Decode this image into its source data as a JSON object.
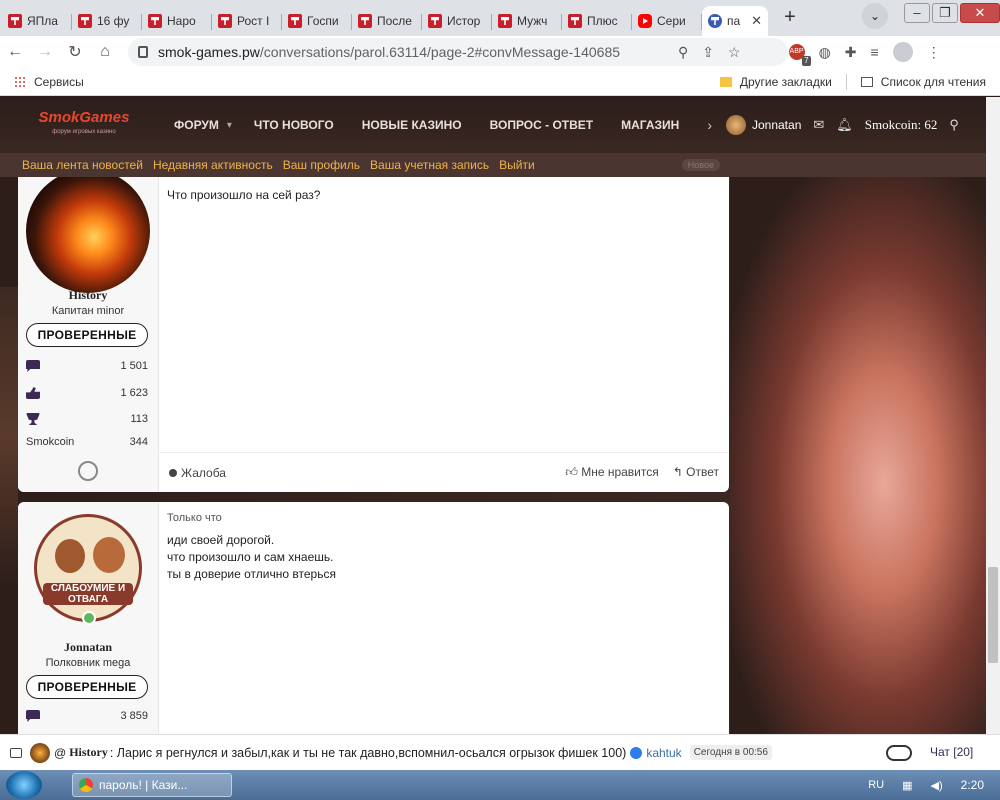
{
  "browser": {
    "tabs": [
      {
        "label": "ЯПла",
        "favicon": "sg-red"
      },
      {
        "label": "16 фу",
        "favicon": "sg-red"
      },
      {
        "label": "Наро",
        "favicon": "sg-red"
      },
      {
        "label": "Рост I",
        "favicon": "sg-red"
      },
      {
        "label": "Госпи",
        "favicon": "sg-red"
      },
      {
        "label": "После",
        "favicon": "sg-red"
      },
      {
        "label": "Истор",
        "favicon": "sg-red"
      },
      {
        "label": "Мужч",
        "favicon": "sg-red"
      },
      {
        "label": "Плюс",
        "favicon": "sg-red"
      },
      {
        "label": "Сери",
        "favicon": "youtube"
      },
      {
        "label": "па",
        "favicon": "smokgames",
        "active": true
      }
    ],
    "url_host": "smok-games.pw",
    "url_path": "/conversations/parol.63114/page-2#convMessage-140685",
    "abp_count": "7",
    "bookmarks": {
      "apps": "Сервисы",
      "other": "Другие закладки",
      "reading_list": "Список для чтения"
    }
  },
  "site": {
    "logo": "SmokGames",
    "logo_sub": "форум игровых казино",
    "nav": [
      "ФОРУМ",
      "ЧТО НОВОГО",
      "НОВЫЕ КАЗИНО",
      "ВОПРОС - ОТВЕТ",
      "МАГАЗИН"
    ],
    "username": "Jonnatan",
    "smokcoin": "Smokcoin: 62",
    "subnav": [
      "Ваша лента новостей",
      "Недавняя активность",
      "Ваш профиль",
      "Ваша учетная запись",
      "Выйти"
    ],
    "subnav_badge": "Новое"
  },
  "messages": [
    {
      "author": "History",
      "title": "Капитан minor",
      "badge": "ПРОВЕРЕННЫЕ",
      "stats": [
        {
          "icon": "messages-icon",
          "value": "1 501"
        },
        {
          "icon": "likes-icon",
          "value": "1 623"
        },
        {
          "icon": "trophy-icon",
          "value": "113"
        },
        {
          "label": "Smokcoin",
          "value": "344"
        }
      ],
      "time": "",
      "lines": [
        "Что произошло на сей раз?"
      ],
      "report": "Жалоба",
      "like": "Мне нравится",
      "reply": "Ответ"
    },
    {
      "author": "Jonnatan",
      "title": "Полковник mega",
      "badge": "ПРОВЕРЕННЫЕ",
      "avatar_text": "СЛАБОУМИЕ И ОТВАГА",
      "stats": [
        {
          "icon": "messages-icon",
          "value": "3 859"
        }
      ],
      "time": "Только что",
      "lines": [
        "иди своей дорогой.",
        "что произошло и сам хнаешь.",
        "ты в доверие отлично втерься"
      ]
    }
  ],
  "chat": {
    "at": "@",
    "name": "History",
    "text": ": Ларис я регнулся и забыл,как и ты не так давно,вспомнил-осьался огрызок фишек 100)",
    "who": "kahtuk",
    "time": "Сегодня в 00:56",
    "button": "Чат [20]"
  },
  "taskbar": {
    "task": "пароль! | Кази...",
    "lang": "RU",
    "clock": "2:20"
  }
}
